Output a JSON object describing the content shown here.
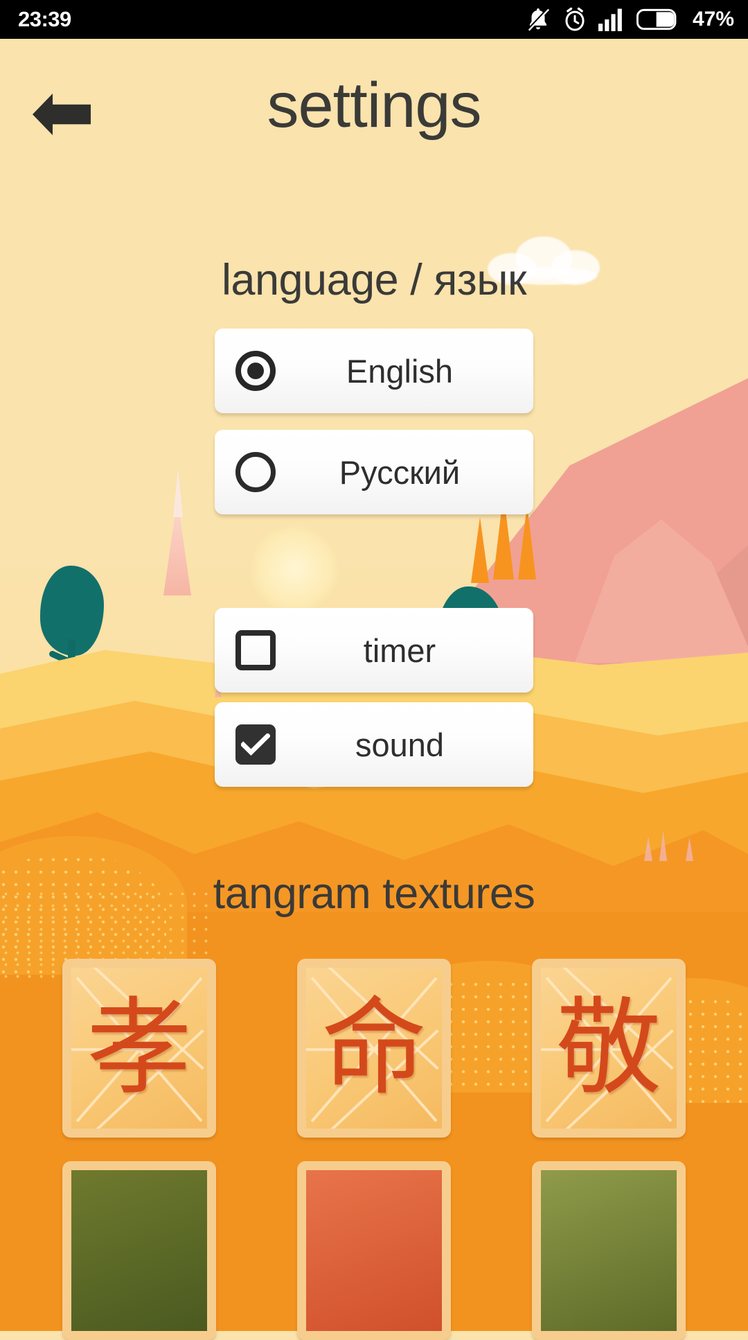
{
  "status_bar": {
    "time": "23:39",
    "battery_percent": "47%",
    "icons": [
      "bell-muted-icon",
      "alarm-clock-icon",
      "signal-bars-icon",
      "battery-icon"
    ]
  },
  "header": {
    "back_icon": "back-arrow-icon",
    "title": "settings"
  },
  "language_section": {
    "header": "language / язык",
    "options": [
      {
        "label": "English",
        "selected": true,
        "control": "radio"
      },
      {
        "label": "Русский",
        "selected": false,
        "control": "radio"
      }
    ]
  },
  "toggles": [
    {
      "label": "timer",
      "checked": false,
      "control": "checkbox"
    },
    {
      "label": "sound",
      "checked": true,
      "control": "checkbox"
    }
  ],
  "textures_section": {
    "header": "tangram textures",
    "tiles": [
      {
        "glyph": "孝",
        "name": "texture-tile-xiao"
      },
      {
        "glyph": "命",
        "name": "texture-tile-ming"
      },
      {
        "glyph": "敬",
        "name": "texture-tile-jing"
      }
    ]
  },
  "colors": {
    "sky": "#fae3ac",
    "ground": "#f3931f",
    "mountain": "#f0a193",
    "tree": "#12706a",
    "conifer": "#f79420",
    "text": "#3a3a38",
    "card": "#ffffff",
    "glyph": "#d4491b",
    "status_bar": "#000000"
  }
}
